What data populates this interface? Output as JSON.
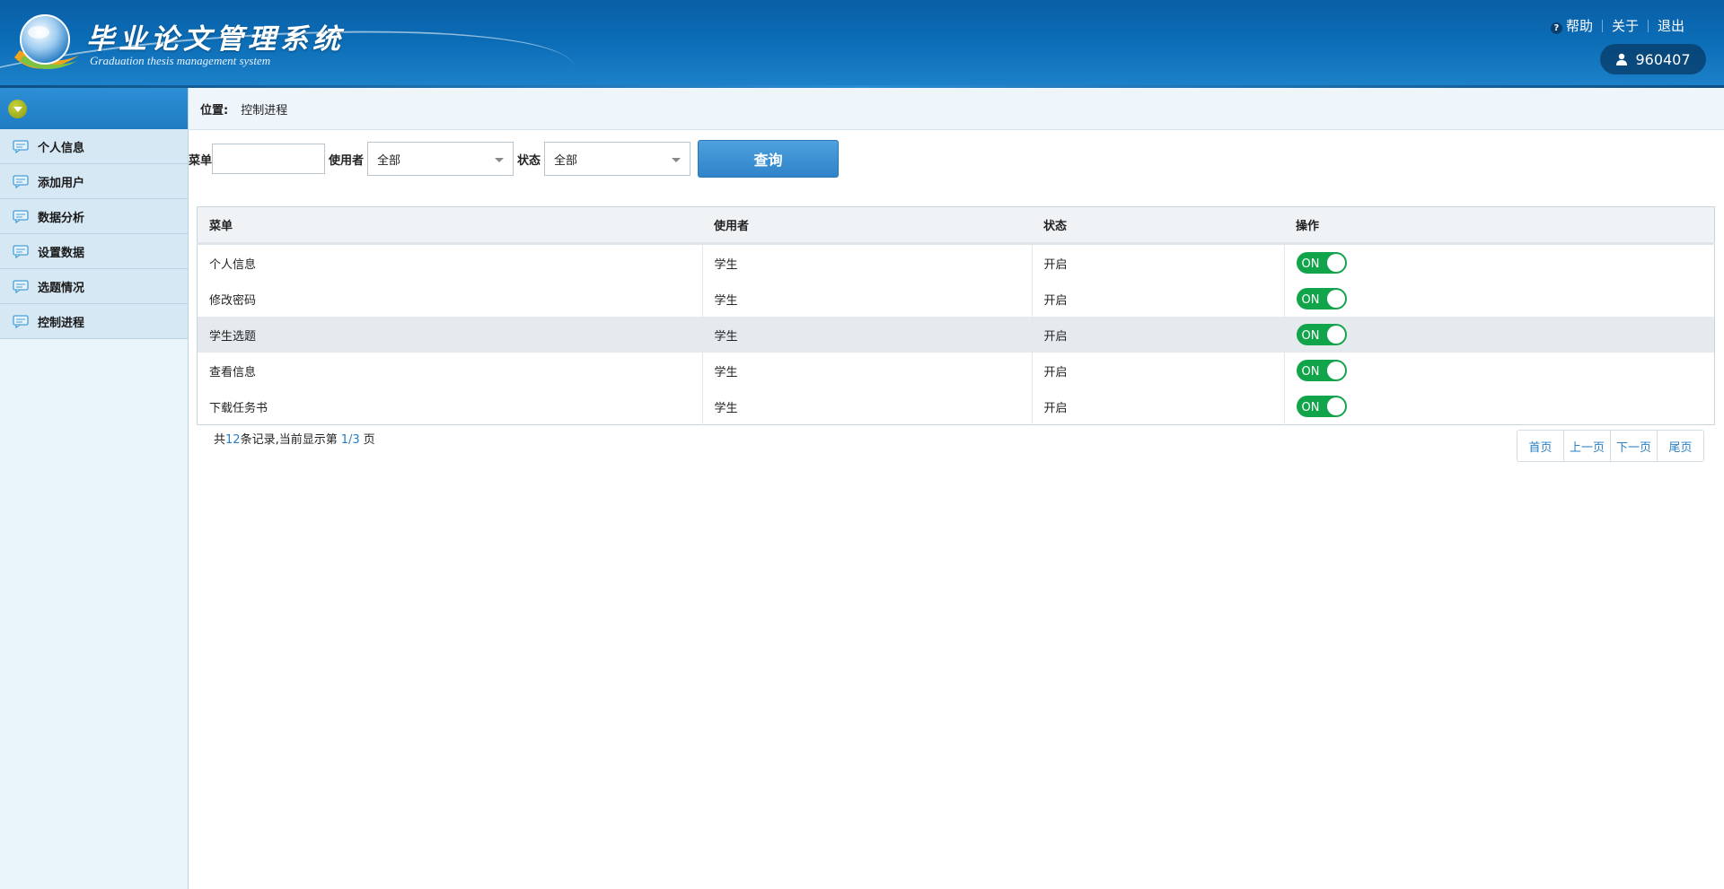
{
  "header": {
    "title": "毕业论文管理系统",
    "subtitle": "Graduation thesis management system",
    "links": {
      "help": "帮助",
      "about": "关于",
      "logout": "退出"
    },
    "user_id": "960407"
  },
  "sidebar": {
    "items": [
      {
        "label": "个人信息"
      },
      {
        "label": "添加用户"
      },
      {
        "label": "数据分析"
      },
      {
        "label": "设置数据"
      },
      {
        "label": "选题情况"
      },
      {
        "label": "控制进程"
      }
    ]
  },
  "breadcrumb": {
    "label": "位置:",
    "value": "控制进程"
  },
  "filters": {
    "menu_label": "菜单",
    "menu_value": "",
    "user_label": "使用者",
    "user_selected": "全部",
    "status_label": "状态",
    "status_selected": "全部",
    "query_button": "查询"
  },
  "table": {
    "columns": [
      "菜单",
      "使用者",
      "状态",
      "操作"
    ],
    "rows": [
      {
        "menu": "个人信息",
        "user": "学生",
        "status": "开启",
        "toggle": "ON"
      },
      {
        "menu": "修改密码",
        "user": "学生",
        "status": "开启",
        "toggle": "ON"
      },
      {
        "menu": "学生选题",
        "user": "学生",
        "status": "开启",
        "toggle": "ON"
      },
      {
        "menu": "查看信息",
        "user": "学生",
        "status": "开启",
        "toggle": "ON"
      },
      {
        "menu": "下载任务书",
        "user": "学生",
        "status": "开启",
        "toggle": "ON"
      }
    ]
  },
  "pagination": {
    "prefix": "共",
    "total": "12",
    "mid": "条记录,当前显示第",
    "current": "1/3",
    "suffix": "页",
    "first": "首页",
    "prev": "上一页",
    "next": "下一页",
    "last": "尾页"
  },
  "colors": {
    "header_blue": "#0b6cb6",
    "toggle_green": "#12a44a",
    "link_blue": "#2a7ec3"
  }
}
